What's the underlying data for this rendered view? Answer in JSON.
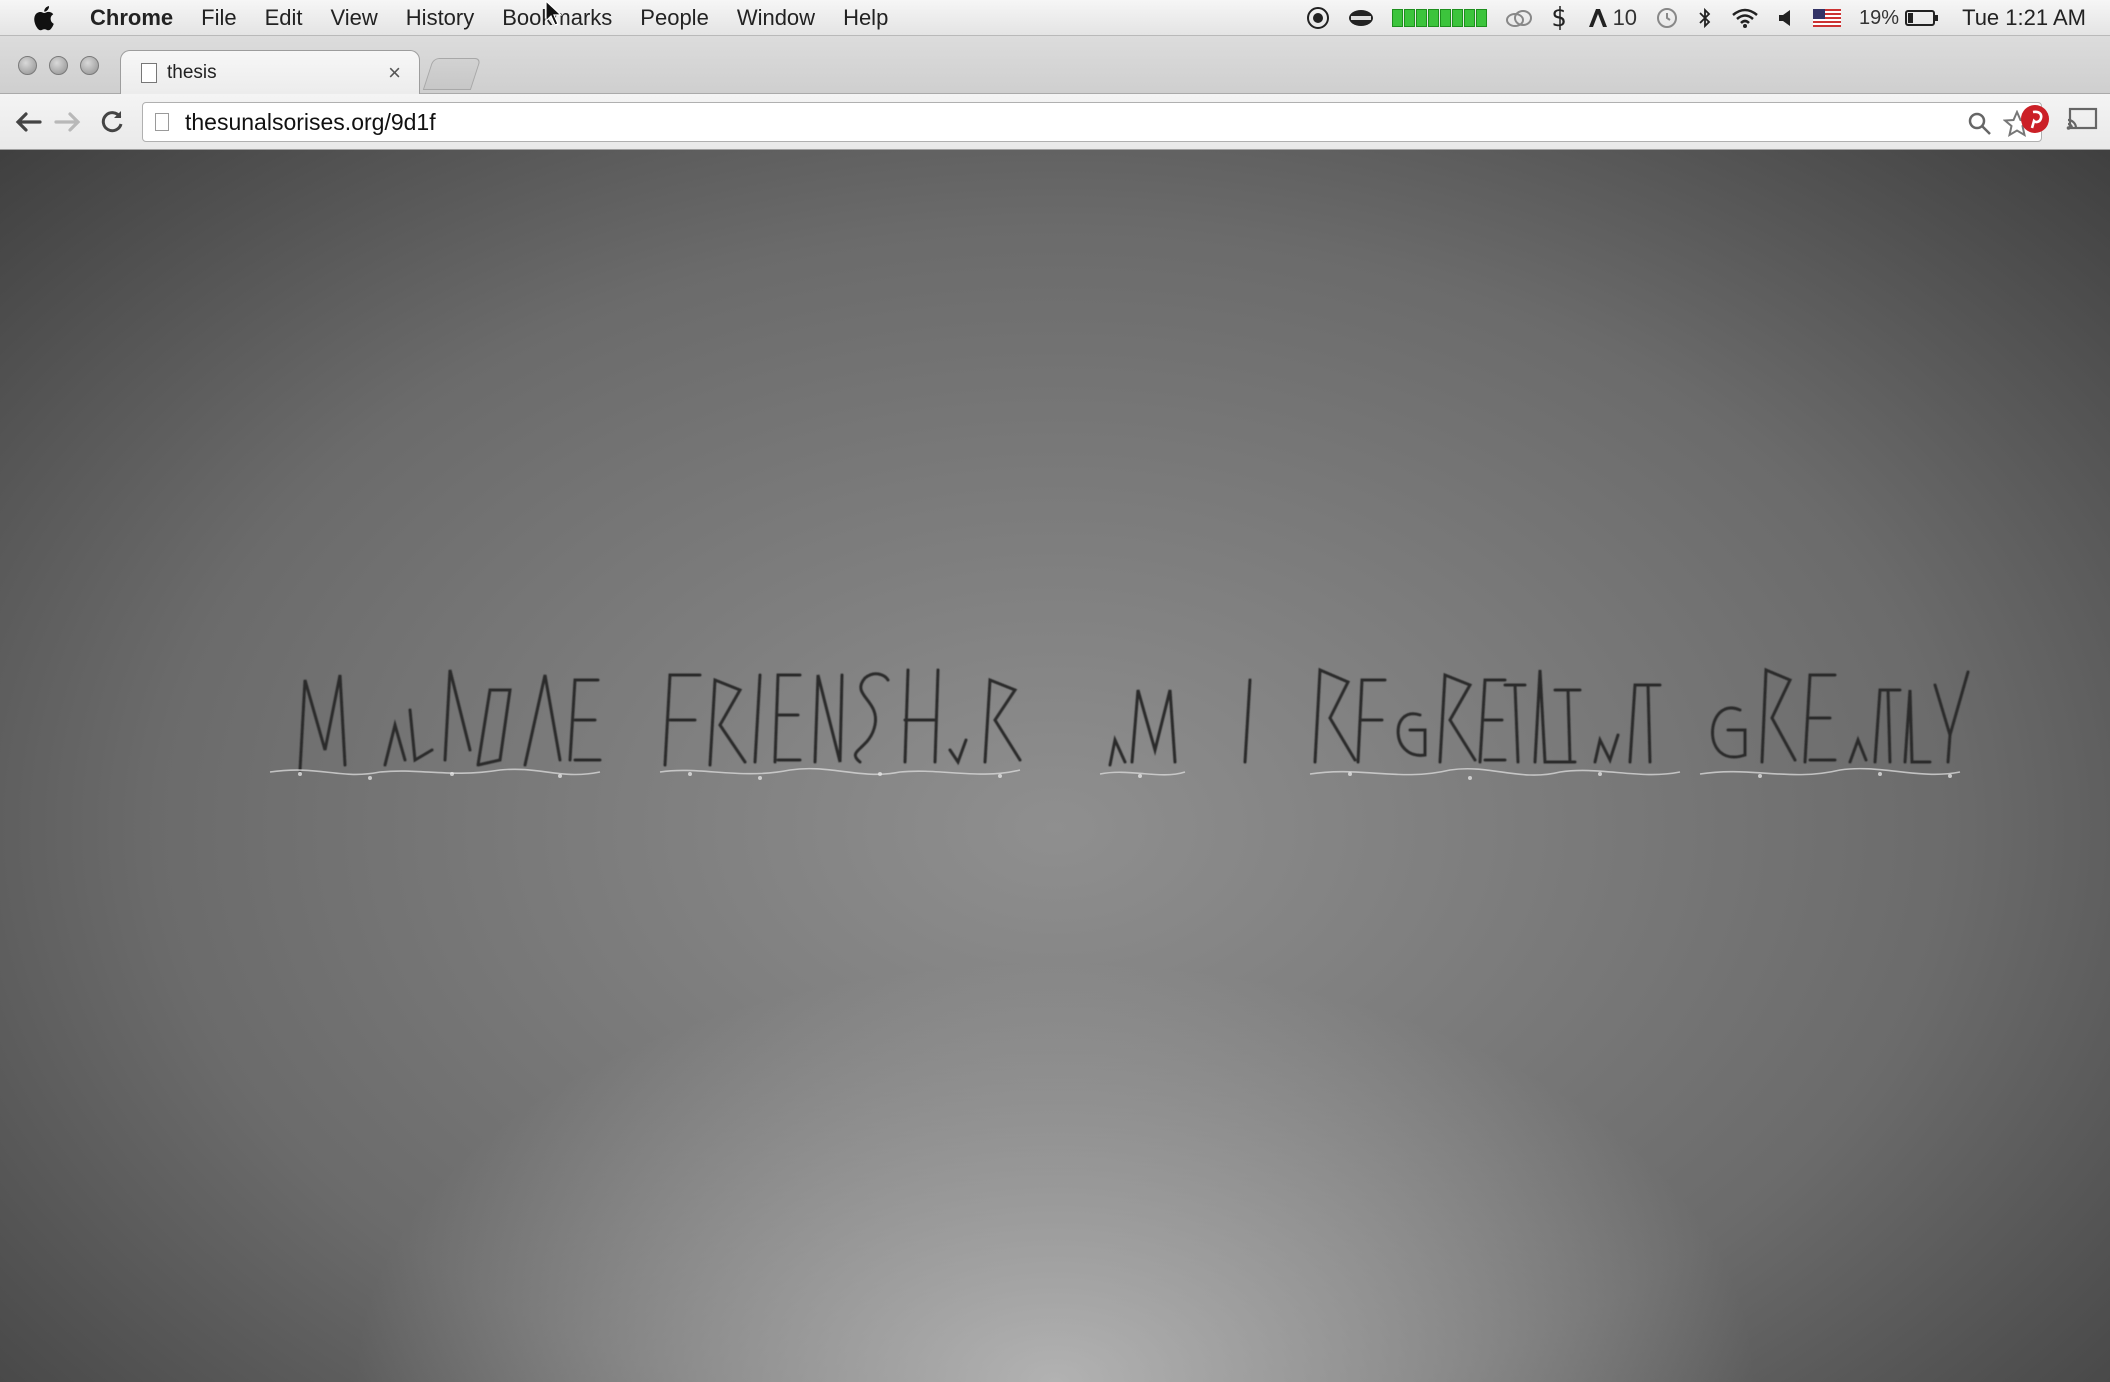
{
  "menubar": {
    "app_name": "Chrome",
    "menus": [
      "File",
      "Edit",
      "View",
      "History",
      "Bookmarks",
      "People",
      "Window",
      "Help"
    ],
    "status": {
      "notification_count": "10",
      "battery_percent": "19%",
      "clock": "Tue 1:21 AM",
      "input_flag": "us-flag-icon"
    }
  },
  "browser": {
    "tab_title": "thesis",
    "tab_close": "×",
    "url": "thesunalsorises.org/9d1f"
  },
  "page": {
    "artwork_text": "MY LOVE FRIENDSHIP AM I REGRET THAT GREATLY",
    "background_color": "#6b6b6b"
  }
}
